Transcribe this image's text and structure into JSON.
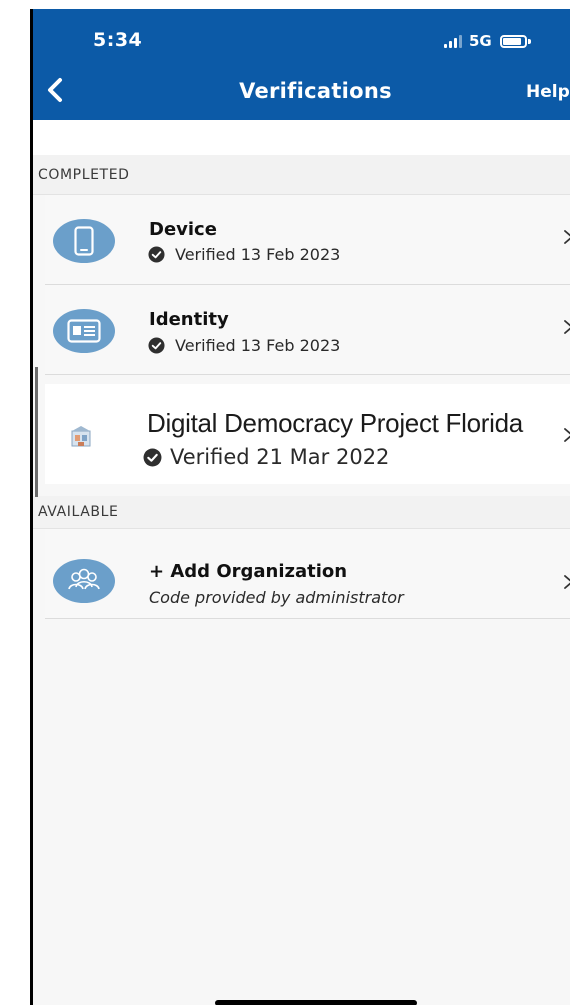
{
  "status_bar": {
    "time": "5:34",
    "network": "5G"
  },
  "nav": {
    "title": "Verifications",
    "help_label": "Help"
  },
  "sections": {
    "completed_label": "COMPLETED",
    "available_label": "AVAILABLE"
  },
  "completed_items": [
    {
      "title": "Device",
      "status": "Verified 13 Feb 2023",
      "icon": "phone-icon"
    },
    {
      "title": "Identity",
      "status": "Verified 13 Feb 2023",
      "icon": "id-card-icon"
    },
    {
      "title": "Digital Democracy Project Florida",
      "status": "Verified 21 Mar 2022",
      "icon": "organization-logo"
    }
  ],
  "available_items": [
    {
      "title": "+ Add Organization",
      "subtitle": "Code provided by administrator",
      "icon": "group-icon"
    }
  ],
  "colors": {
    "header_bg": "#0c5aa7",
    "avatar_bg": "#6b9fca",
    "section_bg": "#f2f2f2",
    "row_bg": "#f8f8f8"
  }
}
